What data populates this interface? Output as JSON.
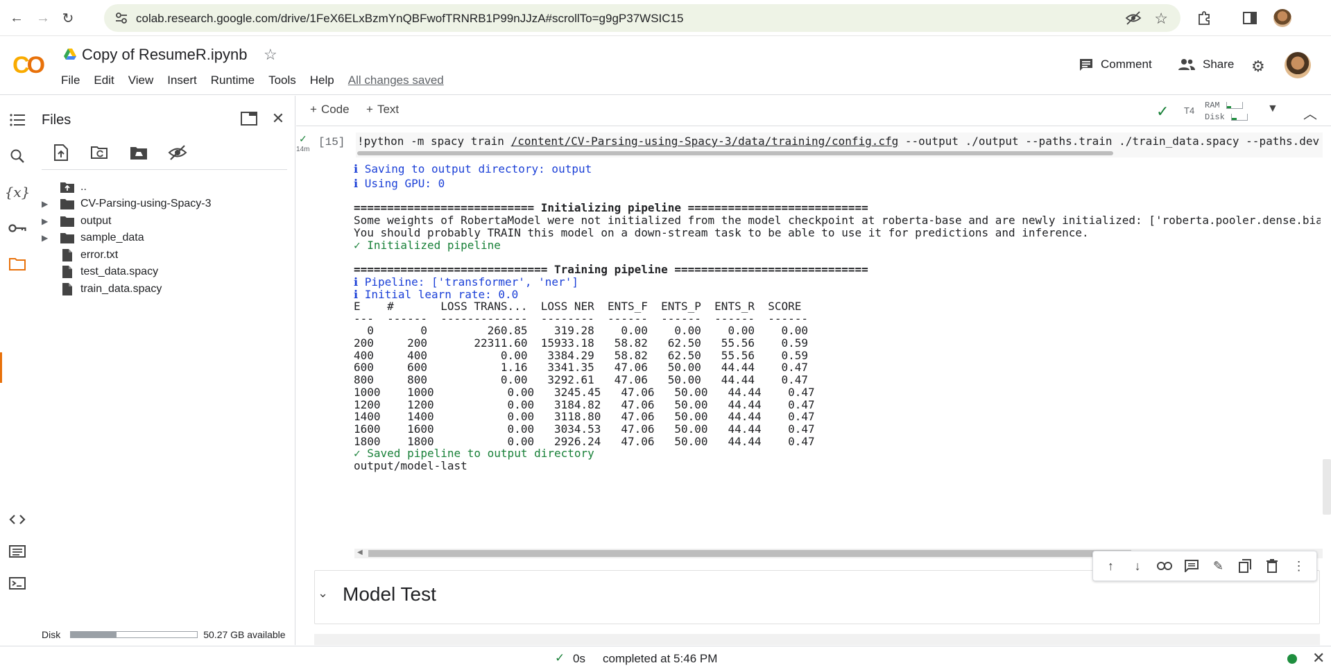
{
  "browser": {
    "url": "colab.research.google.com/drive/1FeX6ELxBzmYnQBFwofTRNRB1P99nJJzA#scrollTo=g9gP37WSIC15"
  },
  "header": {
    "logo": "CO",
    "title": "Copy of ResumeR.ipynb",
    "menu": [
      "File",
      "Edit",
      "View",
      "Insert",
      "Runtime",
      "Tools",
      "Help"
    ],
    "saved_status": "All changes saved",
    "comment_label": "Comment",
    "share_label": "Share"
  },
  "files": {
    "title": "Files",
    "tree": [
      {
        "name": "..",
        "type": "parent",
        "expandable": false
      },
      {
        "name": "CV-Parsing-using-Spacy-3",
        "type": "folder",
        "expandable": true
      },
      {
        "name": "output",
        "type": "folder",
        "expandable": true
      },
      {
        "name": "sample_data",
        "type": "folder",
        "expandable": true
      },
      {
        "name": "error.txt",
        "type": "file",
        "expandable": false
      },
      {
        "name": "test_data.spacy",
        "type": "file",
        "expandable": false
      },
      {
        "name": "train_data.spacy",
        "type": "file",
        "expandable": false
      }
    ],
    "disk_label": "Disk",
    "disk_available": "50.27 GB available",
    "disk_used_fraction": 0.36
  },
  "toolbar": {
    "code_label": "Code",
    "text_label": "Text",
    "gpu": "T4",
    "ram_label": "RAM",
    "disk_label": "Disk"
  },
  "cell": {
    "exec_count": "[15]",
    "run_time": "14m",
    "code_prefix": "!python -m spacy train ",
    "code_path": "/content/CV-Parsing-using-Spacy-3/data/training/config.cfg",
    "code_rest": " --output ./output --paths.train ./train_data.spacy --paths.dev",
    "output": {
      "saving": "ℹ Saving to output directory: output",
      "gpu": "ℹ Using GPU: 0",
      "init_header": "=========================== Initializing pipeline ===========================",
      "warn1": "Some weights of RobertaModel were not initialized from the model checkpoint at roberta-base and are newly initialized: ['roberta.pooler.dense.bia",
      "warn2": "You should probably TRAIN this model on a down-stream task to be able to use it for predictions and inference.",
      "initialized": "✓ Initialized pipeline",
      "train_header": "============================= Training pipeline =============================",
      "pipeline": "ℹ Pipeline: ['transformer', 'ner']",
      "learn_rate": "ℹ Initial learn rate: 0.0",
      "table_header": "E    #       LOSS TRANS...  LOSS NER  ENTS_F  ENTS_P  ENTS_R  SCORE",
      "table_sep": "---  ------  -------------  --------  ------  ------  ------  ------",
      "rows": [
        "  0       0         260.85    319.28    0.00    0.00    0.00    0.00",
        "200     200       22311.60  15933.18   58.82   62.50   55.56    0.59",
        "400     400           0.00   3384.29   58.82   62.50   55.56    0.59",
        "600     600           1.16   3341.35   47.06   50.00   44.44    0.47",
        "800     800           0.00   3292.61   47.06   50.00   44.44    0.47",
        "1000    1000           0.00   3245.45   47.06   50.00   44.44    0.47",
        "1200    1200           0.00   3184.82   47.06   50.00   44.44    0.47",
        "1400    1400           0.00   3118.80   47.06   50.00   44.44    0.47",
        "1600    1600           0.00   3034.53   47.06   50.00   44.44    0.47",
        "1800    1800           0.00   2926.24   47.06   50.00   44.44    0.47"
      ],
      "saved": "✓ Saved pipeline to output directory",
      "model_path": "output/model-last"
    }
  },
  "text_cell": {
    "heading": "Model Test"
  },
  "status": {
    "duration": "0s",
    "completed": "completed at 5:46 PM"
  },
  "colors": {
    "accent": "#e8710a",
    "logo_yellow": "#f9ab00",
    "success": "#188038",
    "info": "#1a3fd7"
  }
}
